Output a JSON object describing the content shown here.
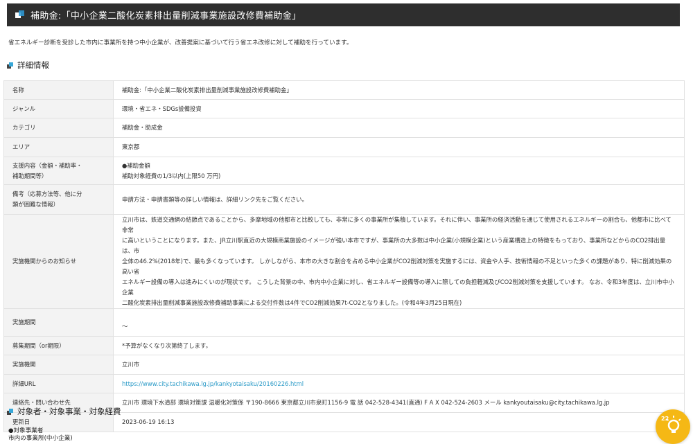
{
  "header": {
    "title": "補助金:「中小企業二酸化炭素排出量削減事業施設改修費補助金」"
  },
  "intro": "省エネルギー診断を受診した市内に事業所を持つ中小企業が、改善提案に基づいて行う省エネ改修に対して補助を行っています。",
  "sections": {
    "detail_title": "詳細情報",
    "target_title": "対象者・対象事業・対象経費"
  },
  "details": [
    {
      "label": [
        "名称"
      ],
      "value": [
        "補助金:「中小企業二酸化炭素排出量削減事業施設改修費補助金」"
      ]
    },
    {
      "label": [
        "ジャンル"
      ],
      "value": [
        "環境・省エネ・SDGs設備投資"
      ]
    },
    {
      "label": [
        "カテゴリ"
      ],
      "value": [
        "補助金・助成金"
      ]
    },
    {
      "label": [
        "エリア"
      ],
      "value": [
        "東京都"
      ]
    },
    {
      "label": [
        "支援内容（金額・補助率・",
        "補助期間等）"
      ],
      "value": [
        "●補助金額",
        "補助対象経費の1/3以内(上限50 万円)"
      ]
    },
    {
      "label": [
        "備考（応募方法等、他に分",
        "類が困難な情報）"
      ],
      "value": [
        "申請方法・申請書類等の詳しい情報は、詳細リンク先をご覧ください。"
      ]
    },
    {
      "label": [
        "実施機関からのお知らせ"
      ],
      "value": [
        "立川市は、鉄道交通網の結節点であることから、多摩地域の他都市と比較しても、非常に多くの事業所が集積しています。それに伴い、事業所の経済活動を通じて使用されるエネルギーの割合も、他都市に比べて非常",
        "に高いということになります。また、JR立川駅直近の大規模商業施設のイメージが強い本市ですが、事業所の大多数は中小企業(小規模企業)という産業構造上の特徴をもっており、事業所などからのCO2排出量は、市",
        "全体の46.2%(2018年)で、最も多くなっています。 しかしながら、本市の大きな割合を占める中小企業がCO2削減対策を実施するには、資金や人手、技術情報の不足といった多くの課題があり、特に削減効果の高い省",
        "エネルギー設備の導入は進みにくいのが現状です。 こうした背景の中、市内中小企業に対し、省エネルギー設備等の導入に際しての負担軽減及びCO2削減対策を支援しています。 なお、令和3年度は、立川市中小企業",
        "二酸化炭素排出量削減事業施設改修費補助事業による交付件数は4件でCO2削減効果7t-CO2となりました。(令和4年3月25日現在)"
      ]
    },
    {
      "label": [
        "実施期間"
      ],
      "value": [
        "～"
      ]
    },
    {
      "label": [
        "募集期間（or期限）"
      ],
      "value": [
        "*予算がなくなり次第終了します。"
      ]
    },
    {
      "label": [
        "実施機関"
      ],
      "value": [
        "立川市"
      ]
    },
    {
      "label": [
        "詳細URL"
      ],
      "value": [
        "https://www.city.tachikawa.lg.jp/kankyotaisaku/20160226.html"
      ],
      "link": true
    },
    {
      "label": [
        "連絡先・問い合わせ先"
      ],
      "value": [
        "立川市 環境下水道部 環境対策課 温暖化対策係 〒190-8666 東京都立川市泉町1156-9 電 話 042-528-4341(直通) F A X 042-524-2603 メール kankyoutaisaku@city.tachikawa.lg.jp"
      ]
    },
    {
      "label": [
        "更新日"
      ],
      "value": [
        "2023-06-19 16:13"
      ]
    }
  ],
  "target_lines": [
    "●対象事業者",
    "市内の事業所(中小企業)"
  ],
  "badge": {
    "count": "22",
    "icon": "lightbulb-icon",
    "color": "#f5b815"
  },
  "colors": {
    "header_bg": "#2e2e2e",
    "label_bg": "#f3f3f3",
    "link": "#2a9ac7",
    "accent": "#37a7d8"
  }
}
